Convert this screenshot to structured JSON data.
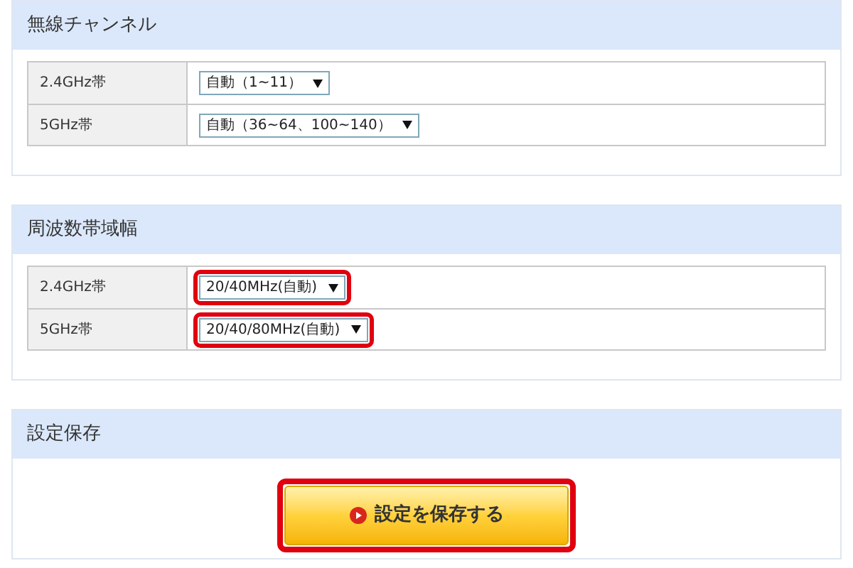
{
  "sections": [
    {
      "title": "無線チャンネル",
      "kind": "table",
      "rows": [
        {
          "label": "2.4GHz帯",
          "value": "自動（1~11）",
          "highlighted": false
        },
        {
          "label": "5GHz帯",
          "value": "自動（36~64、100~140）",
          "highlighted": false
        }
      ]
    },
    {
      "title": "周波数帯域幅",
      "kind": "table",
      "rows": [
        {
          "label": "2.4GHz帯",
          "value": "20/40MHz(自動)",
          "highlighted": true
        },
        {
          "label": "5GHz帯",
          "value": "20/40/80MHz(自動)",
          "highlighted": true
        }
      ]
    },
    {
      "title": "設定保存",
      "kind": "button",
      "button": {
        "label": "設定を保存する",
        "highlighted": true
      }
    }
  ]
}
